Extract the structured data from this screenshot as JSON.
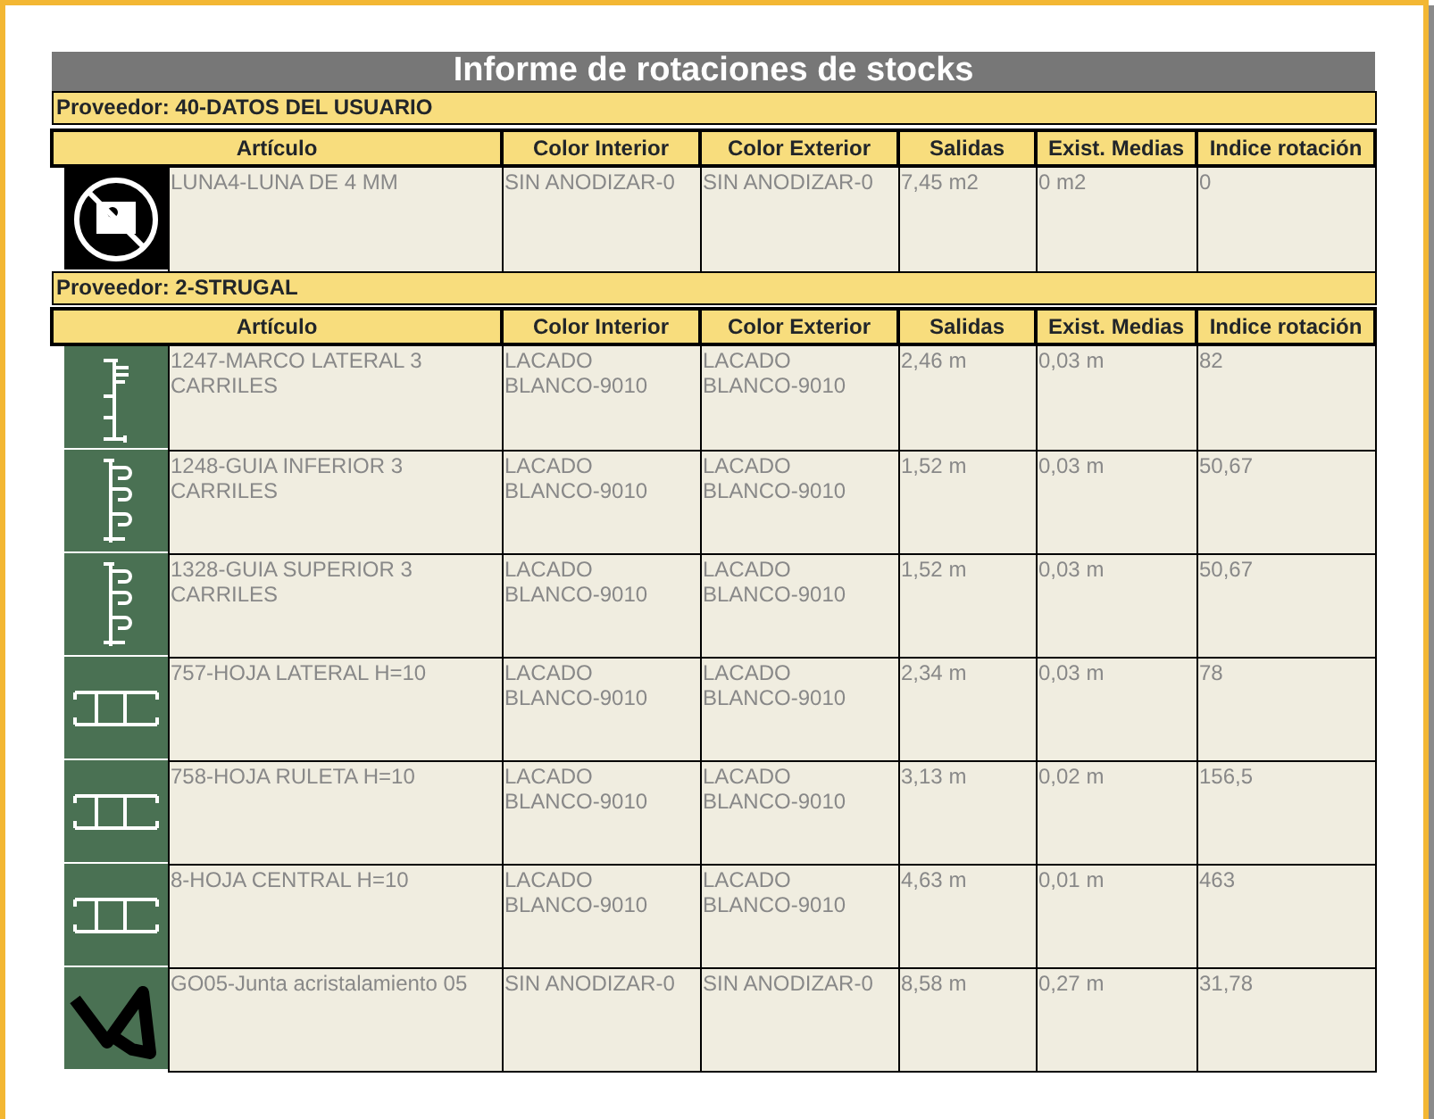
{
  "title": "Informe de rotaciones de stocks",
  "groups": [
    {
      "provider": "Proveedor: 40-DATOS DEL USUARIO",
      "columns": [
        "Artículo",
        "Color Interior",
        "Color Exterior",
        "Salidas",
        "Exist. Medias",
        "Indice rotación"
      ],
      "rows": [
        {
          "kind": "no-image",
          "cells": [
            "LUNA4-LUNA DE 4 MM",
            "SIN ANODIZAR-0",
            "SIN ANODIZAR-0",
            "7,45 m2",
            "0 m2",
            "0"
          ]
        }
      ]
    },
    {
      "provider": "Proveedor: 2-STRUGAL",
      "columns": [
        "Artículo",
        "Color Interior",
        "Color Exterior",
        "Salidas",
        "Exist. Medias",
        "Indice rotación"
      ],
      "rows": [
        {
          "kind": "frame-profile",
          "cells": [
            "1247-MARCO LATERAL 3 CARRILES",
            "LACADO BLANCO-9010",
            "LACADO BLANCO-9010",
            "2,46 m",
            "0,03 m",
            "82"
          ]
        },
        {
          "kind": "guide-profile",
          "cells": [
            "1248-GUIA INFERIOR 3 CARRILES",
            "LACADO BLANCO-9010",
            "LACADO BLANCO-9010",
            "1,52 m",
            "0,03 m",
            "50,67"
          ]
        },
        {
          "kind": "guide-profile",
          "cells": [
            "1328-GUIA SUPERIOR 3 CARRILES",
            "LACADO BLANCO-9010",
            "LACADO BLANCO-9010",
            "1,52 m",
            "0,03 m",
            "50,67"
          ]
        },
        {
          "kind": "sash-profile",
          "cells": [
            "757-HOJA LATERAL H=10",
            "LACADO BLANCO-9010",
            "LACADO BLANCO-9010",
            "2,34 m",
            "0,03 m",
            "78"
          ]
        },
        {
          "kind": "sash-profile",
          "cells": [
            "758-HOJA RULETA H=10",
            "LACADO BLANCO-9010",
            "LACADO BLANCO-9010",
            "3,13 m",
            "0,02 m",
            "156,5"
          ]
        },
        {
          "kind": "sash-profile",
          "cells": [
            "8-HOJA CENTRAL H=10",
            "LACADO BLANCO-9010",
            "LACADO BLANCO-9010",
            "4,63 m",
            "0,01 m",
            "463"
          ]
        },
        {
          "kind": "gasket",
          "cells": [
            "GO05-Junta acristalamiento 05",
            "SIN ANODIZAR-0",
            "SIN ANODIZAR-0",
            "8,58 m",
            "0,27 m",
            "31,78"
          ]
        }
      ]
    }
  ]
}
